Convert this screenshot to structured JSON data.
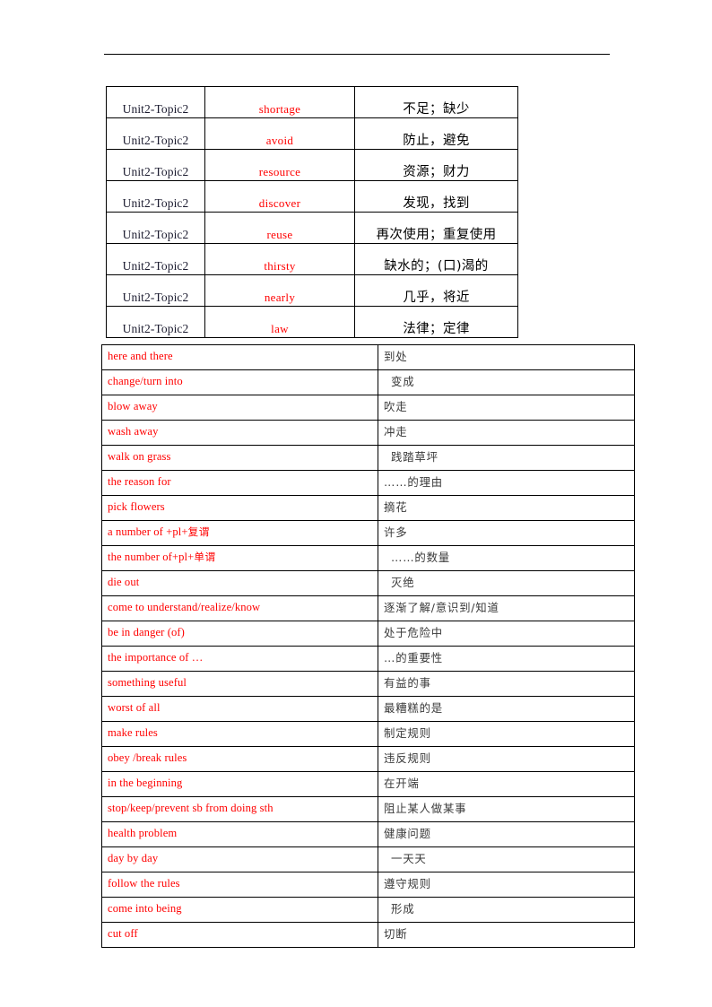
{
  "page": {
    "rule_present": true,
    "accent_red": "#ff0000",
    "text_black": "#000000",
    "zh_gray": "#3a3a3a"
  },
  "vocab_table": {
    "columns": [
      "unit",
      "word",
      "meaning"
    ],
    "rows": [
      {
        "unit": "Unit2-Topic2",
        "word": "shortage",
        "meaning": "不足；缺少"
      },
      {
        "unit": "Unit2-Topic2",
        "word": "avoid",
        "meaning": "防止，避免"
      },
      {
        "unit": "Unit2-Topic2",
        "word": "resource",
        "meaning": "资源；财力"
      },
      {
        "unit": "Unit2-Topic2",
        "word": "discover",
        "meaning": "发现，找到"
      },
      {
        "unit": "Unit2-Topic2",
        "word": "reuse",
        "meaning": "再次使用；重复使用"
      },
      {
        "unit": "Unit2-Topic2",
        "word": "thirsty",
        "meaning": "缺水的；(口)渴的"
      },
      {
        "unit": "Unit2-Topic2",
        "word": "nearly",
        "meaning": "几乎，将近"
      },
      {
        "unit": "Unit2-Topic2",
        "word": "law",
        "meaning": "法律；定律"
      }
    ]
  },
  "phrase_table": {
    "columns": [
      "phrase",
      "meaning"
    ],
    "rows": [
      {
        "phrase": "here and there",
        "meaning": "到处",
        "indent": 0
      },
      {
        "phrase": "change/turn into",
        "meaning": "变成",
        "indent": 1
      },
      {
        "phrase": "blow away",
        "meaning": "吹走",
        "indent": 0
      },
      {
        "phrase": "wash away",
        "meaning": "冲走",
        "indent": 0
      },
      {
        "phrase": "walk on grass",
        "meaning": "践踏草坪",
        "indent": 1
      },
      {
        "phrase": "the reason for",
        "meaning": "……的理由",
        "indent": 0
      },
      {
        "phrase": "pick flowers",
        "meaning": "摘花",
        "indent": 0
      },
      {
        "phrase": "a number of +pl+复谓",
        "meaning": "许多",
        "indent": 0
      },
      {
        "phrase": "the number of+pl+单谓",
        "meaning": "……的数量",
        "indent": 1
      },
      {
        "phrase": "die out",
        "meaning": "灭绝",
        "indent": 1
      },
      {
        "phrase": "come to understand/realize/know",
        "meaning": "逐渐了解/意识到/知道",
        "indent": 0
      },
      {
        "phrase": "be in danger (of)",
        "meaning": "处于危险中",
        "indent": 0
      },
      {
        "phrase": "the importance of …",
        "meaning": "…的重要性",
        "indent": 0
      },
      {
        "phrase": "something useful",
        "meaning": "有益的事",
        "indent": 0
      },
      {
        "phrase": "worst of all",
        "meaning": "最糟糕的是",
        "indent": 0
      },
      {
        "phrase": "make rules",
        "meaning": "制定规则",
        "indent": 0
      },
      {
        "phrase": "obey /break rules",
        "meaning": "违反规则",
        "indent": 0
      },
      {
        "phrase": "in the beginning",
        "meaning": "在开端",
        "indent": 0
      },
      {
        "phrase": "stop/keep/prevent sb from doing sth",
        "meaning": "阻止某人做某事",
        "indent": 0
      },
      {
        "phrase": "health problem",
        "meaning": "健康问题",
        "indent": 0
      },
      {
        "phrase": "day by day",
        "meaning": "一天天",
        "indent": 1
      },
      {
        "phrase": "follow the rules",
        "meaning": "遵守规则",
        "indent": 0
      },
      {
        "phrase": "come into being",
        "meaning": "形成",
        "indent": 1
      },
      {
        "phrase": "cut off",
        "meaning": "切断",
        "indent": 0
      }
    ]
  }
}
